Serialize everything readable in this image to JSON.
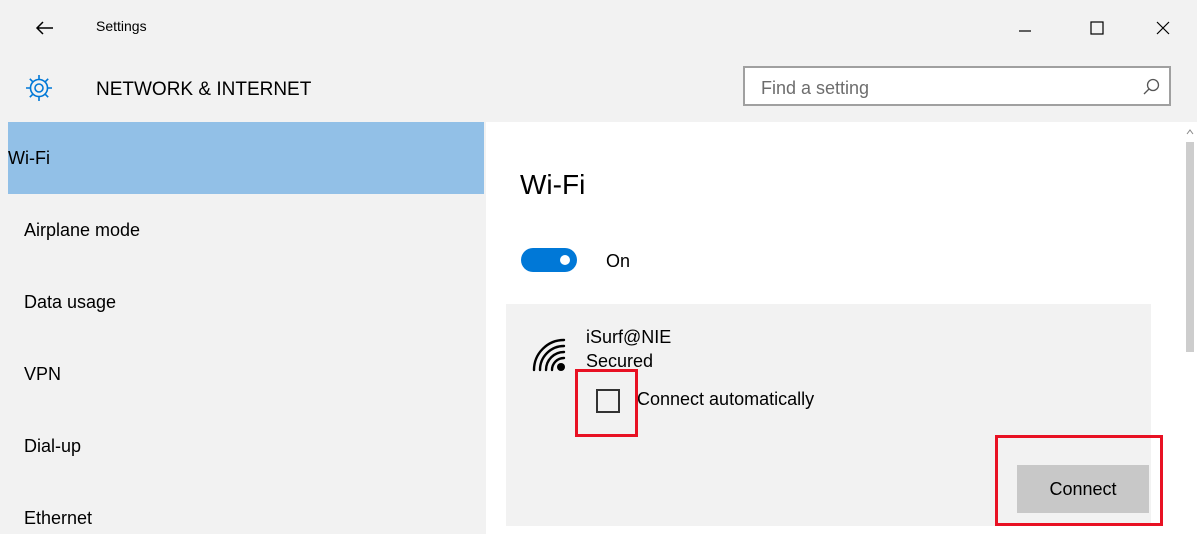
{
  "window": {
    "title": "Settings"
  },
  "header": {
    "section": "NETWORK & INTERNET",
    "search_placeholder": "Find a setting"
  },
  "sidebar": {
    "items": [
      {
        "label": "Wi-Fi",
        "selected": true
      },
      {
        "label": "Airplane mode"
      },
      {
        "label": "Data usage"
      },
      {
        "label": "VPN"
      },
      {
        "label": "Dial-up"
      },
      {
        "label": "Ethernet"
      }
    ]
  },
  "main": {
    "title": "Wi-Fi",
    "toggle_label": "On",
    "toggle_on": true,
    "network": {
      "name": "iSurf@NIE",
      "status": "Secured",
      "auto_connect_label": "Connect automatically",
      "auto_connect_checked": false,
      "connect_label": "Connect"
    }
  },
  "colors": {
    "accent": "#0078d7",
    "selection": "#92c0e7",
    "highlight": "#e81123",
    "chrome": "#f2f2f2"
  },
  "icons": {
    "back": "back-arrow-icon",
    "settings": "gear-icon",
    "search": "search-icon",
    "wifi": "wifi-secured-icon"
  }
}
